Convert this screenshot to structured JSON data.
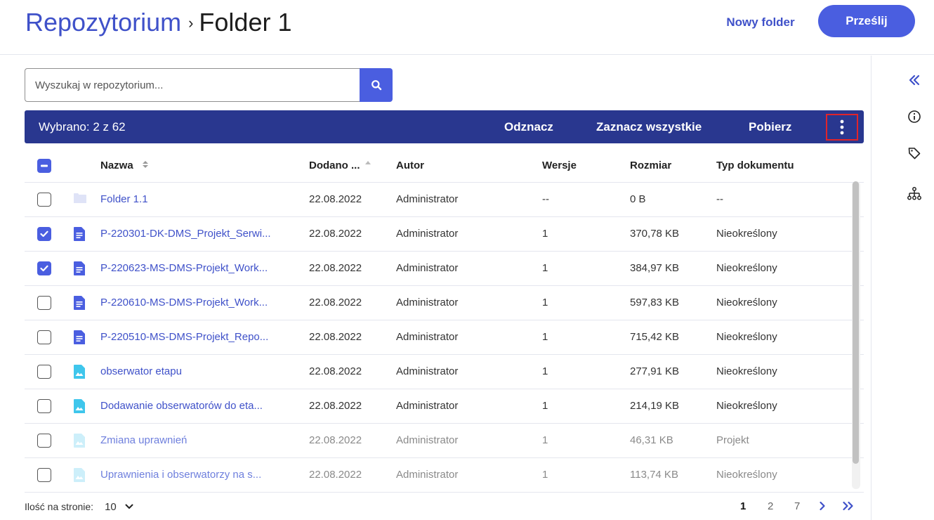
{
  "header": {
    "breadcrumb_root": "Repozytorium",
    "breadcrumb_sep": "›",
    "breadcrumb_current": "Folder 1",
    "new_folder_label": "Nowy folder",
    "upload_label": "Prześlij"
  },
  "search": {
    "placeholder": "Wyszukaj w repozytorium..."
  },
  "selection_bar": {
    "count_label": "Wybrano: 2 z 62",
    "deselect_label": "Odznacz",
    "select_all_label": "Zaznacz wszystkie",
    "download_label": "Pobierz"
  },
  "table": {
    "columns": {
      "name": "Nazwa",
      "added": "Dodano ...",
      "author": "Autor",
      "versions": "Wersje",
      "size": "Rozmiar",
      "doc_type": "Typ dokumentu"
    },
    "rows": [
      {
        "name": "Folder 1.1",
        "added": "22.08.2022",
        "author": "Administrator",
        "versions": "--",
        "size": "0 B",
        "doc_type": "--",
        "icon": "folder-icon",
        "checked": false,
        "faded": false
      },
      {
        "name": "P-220301-DK-DMS_Projekt_Serwi...",
        "added": "22.08.2022",
        "author": "Administrator",
        "versions": "1",
        "size": "370,78 KB",
        "doc_type": "Nieokreślony",
        "icon": "document-icon",
        "checked": true,
        "faded": false
      },
      {
        "name": "P-220623-MS-DMS-Projekt_Work...",
        "added": "22.08.2022",
        "author": "Administrator",
        "versions": "1",
        "size": "384,97 KB",
        "doc_type": "Nieokreślony",
        "icon": "document-icon",
        "checked": true,
        "faded": false
      },
      {
        "name": "P-220610-MS-DMS-Projekt_Work...",
        "added": "22.08.2022",
        "author": "Administrator",
        "versions": "1",
        "size": "597,83 KB",
        "doc_type": "Nieokreślony",
        "icon": "document-icon",
        "checked": false,
        "faded": false
      },
      {
        "name": "P-220510-MS-DMS-Projekt_Repo...",
        "added": "22.08.2022",
        "author": "Administrator",
        "versions": "1",
        "size": "715,42 KB",
        "doc_type": "Nieokreślony",
        "icon": "document-icon",
        "checked": false,
        "faded": false
      },
      {
        "name": "obserwator etapu",
        "added": "22.08.2022",
        "author": "Administrator",
        "versions": "1",
        "size": "277,91 KB",
        "doc_type": "Nieokreślony",
        "icon": "image-icon",
        "checked": false,
        "faded": false
      },
      {
        "name": "Dodawanie obserwatorów do eta...",
        "added": "22.08.2022",
        "author": "Administrator",
        "versions": "1",
        "size": "214,19 KB",
        "doc_type": "Nieokreślony",
        "icon": "image-icon",
        "checked": false,
        "faded": false
      },
      {
        "name": "Zmiana uprawnień",
        "added": "22.08.2022",
        "author": "Administrator",
        "versions": "1",
        "size": "46,31 KB",
        "doc_type": "Projekt",
        "icon": "image-icon",
        "checked": false,
        "faded": true
      },
      {
        "name": "Uprawnienia i obserwatorzy na s...",
        "added": "22.08.2022",
        "author": "Administrator",
        "versions": "1",
        "size": "113,74 KB",
        "doc_type": "Nieokreślony",
        "icon": "image-icon",
        "checked": false,
        "faded": true
      }
    ]
  },
  "footer": {
    "page_size_label": "Ilość na stronie:",
    "page_size_value": "10",
    "pages": [
      "1",
      "2",
      "7"
    ],
    "current_page": "1"
  },
  "colors": {
    "accent": "#4a5ee0",
    "selection_bar": "#29378f",
    "link": "#3f51c9",
    "highlight_border": "#e0242a"
  }
}
